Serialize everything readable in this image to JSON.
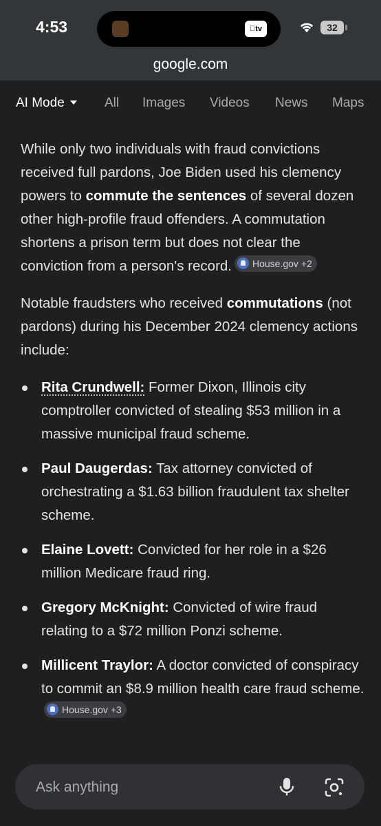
{
  "status_bar": {
    "time": "4:53",
    "tv_badge": "tv",
    "battery": "32"
  },
  "browser": {
    "url": "google.com"
  },
  "tabs": [
    {
      "label": "AI Mode",
      "active": true
    },
    {
      "label": "All"
    },
    {
      "label": "Images"
    },
    {
      "label": "Videos"
    },
    {
      "label": "News"
    },
    {
      "label": "Maps"
    }
  ],
  "content": {
    "p1": {
      "text_a": "While only two individuals with fraud convictions received full pardons, Joe Biden used his clemency powers to ",
      "bold": "commute the sentences",
      "text_b": " of several dozen other high-profile fraud offenders. A commutation shortens a prison term but does not clear the conviction from a person's record.",
      "citation": "House.gov +2"
    },
    "p2": {
      "text_a": "Notable fraudsters who received ",
      "bold": "commutations",
      "text_b": " (not pardons) during his December 2024 clemency actions include:"
    },
    "list": [
      {
        "name": "Rita Crundwell:",
        "text": " Former Dixon, Illinois city comptroller convicted of stealing $53 million in a massive municipal fraud scheme."
      },
      {
        "name": "Paul Daugerdas:",
        "text": " Tax attorney convicted of orchestrating a $1.63 billion fraudulent tax shelter scheme."
      },
      {
        "name": "Elaine Lovett:",
        "text": " Convicted for her role in a $26 million Medicare fraud ring."
      },
      {
        "name": "Gregory McKnight:",
        "text": " Convicted of wire fraud relating to a $72 million Ponzi scheme."
      },
      {
        "name": "Millicent Traylor:",
        "text": " A doctor convicted of conspiracy to commit an $8.9 million health care fraud scheme.",
        "citation": "House.gov +3"
      }
    ]
  },
  "search": {
    "placeholder": "Ask anything"
  },
  "icons": {
    "wifi": "wifi-icon",
    "mic": "microphone-icon",
    "lens": "google-lens-icon",
    "dropdown": "chevron-down-icon",
    "citation": "house-gov-icon"
  }
}
